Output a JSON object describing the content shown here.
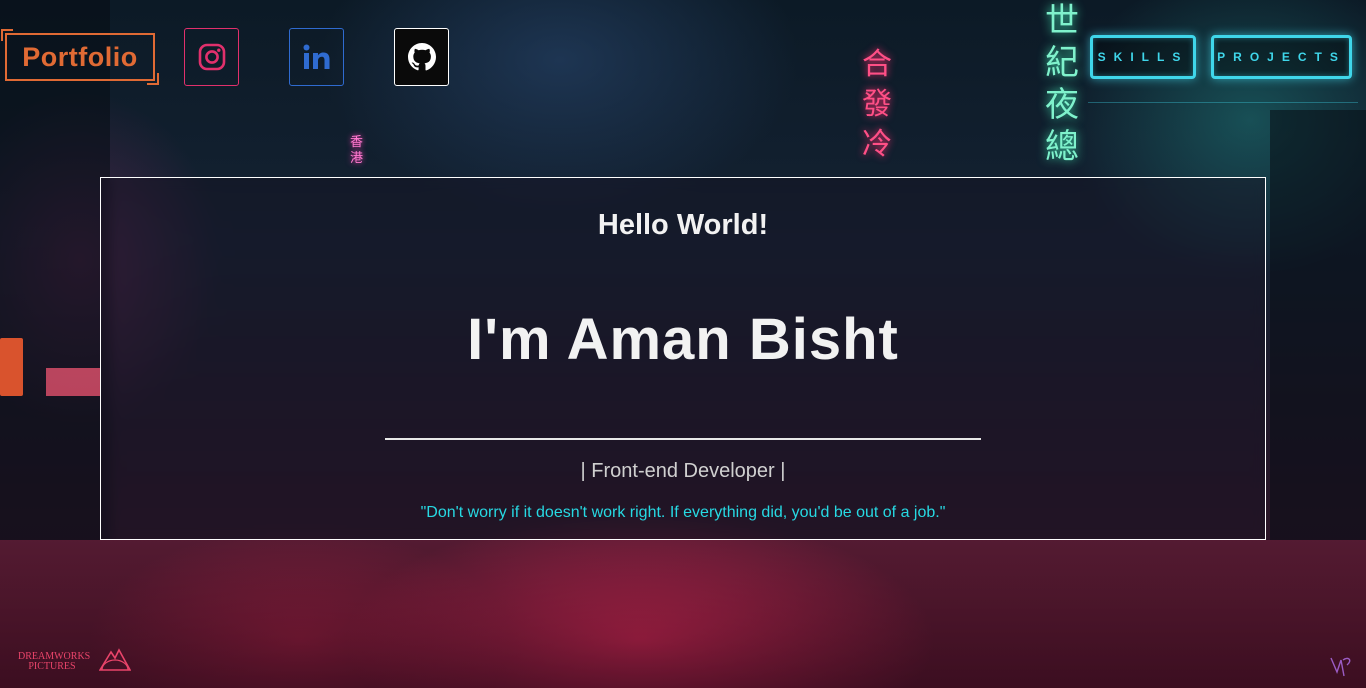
{
  "header": {
    "brand": "Portfolio",
    "social": [
      {
        "name": "Instagram",
        "icon": "instagram-icon",
        "color": "#e1306c"
      },
      {
        "name": "LinkedIn",
        "icon": "linkedin-icon",
        "color": "#2f6bd0"
      },
      {
        "name": "GitHub",
        "icon": "github-icon",
        "color": "#ffffff"
      }
    ],
    "nav": {
      "skills": "SKILLS",
      "projects": "PROJECTS"
    }
  },
  "hero": {
    "greeting": "Hello World!",
    "name": "I'm Aman Bisht",
    "role": "| Front-end Developer |",
    "quote": "\"Don't worry if it doesn't work right. If everything did, you'd be out of a job.\""
  },
  "footer": {
    "logo_dreamworks": "DREAMWORKS PICTURES"
  },
  "colors": {
    "brand": "#e06a34",
    "nav_accent": "#3fd6ea",
    "quote": "#27d9e3"
  }
}
